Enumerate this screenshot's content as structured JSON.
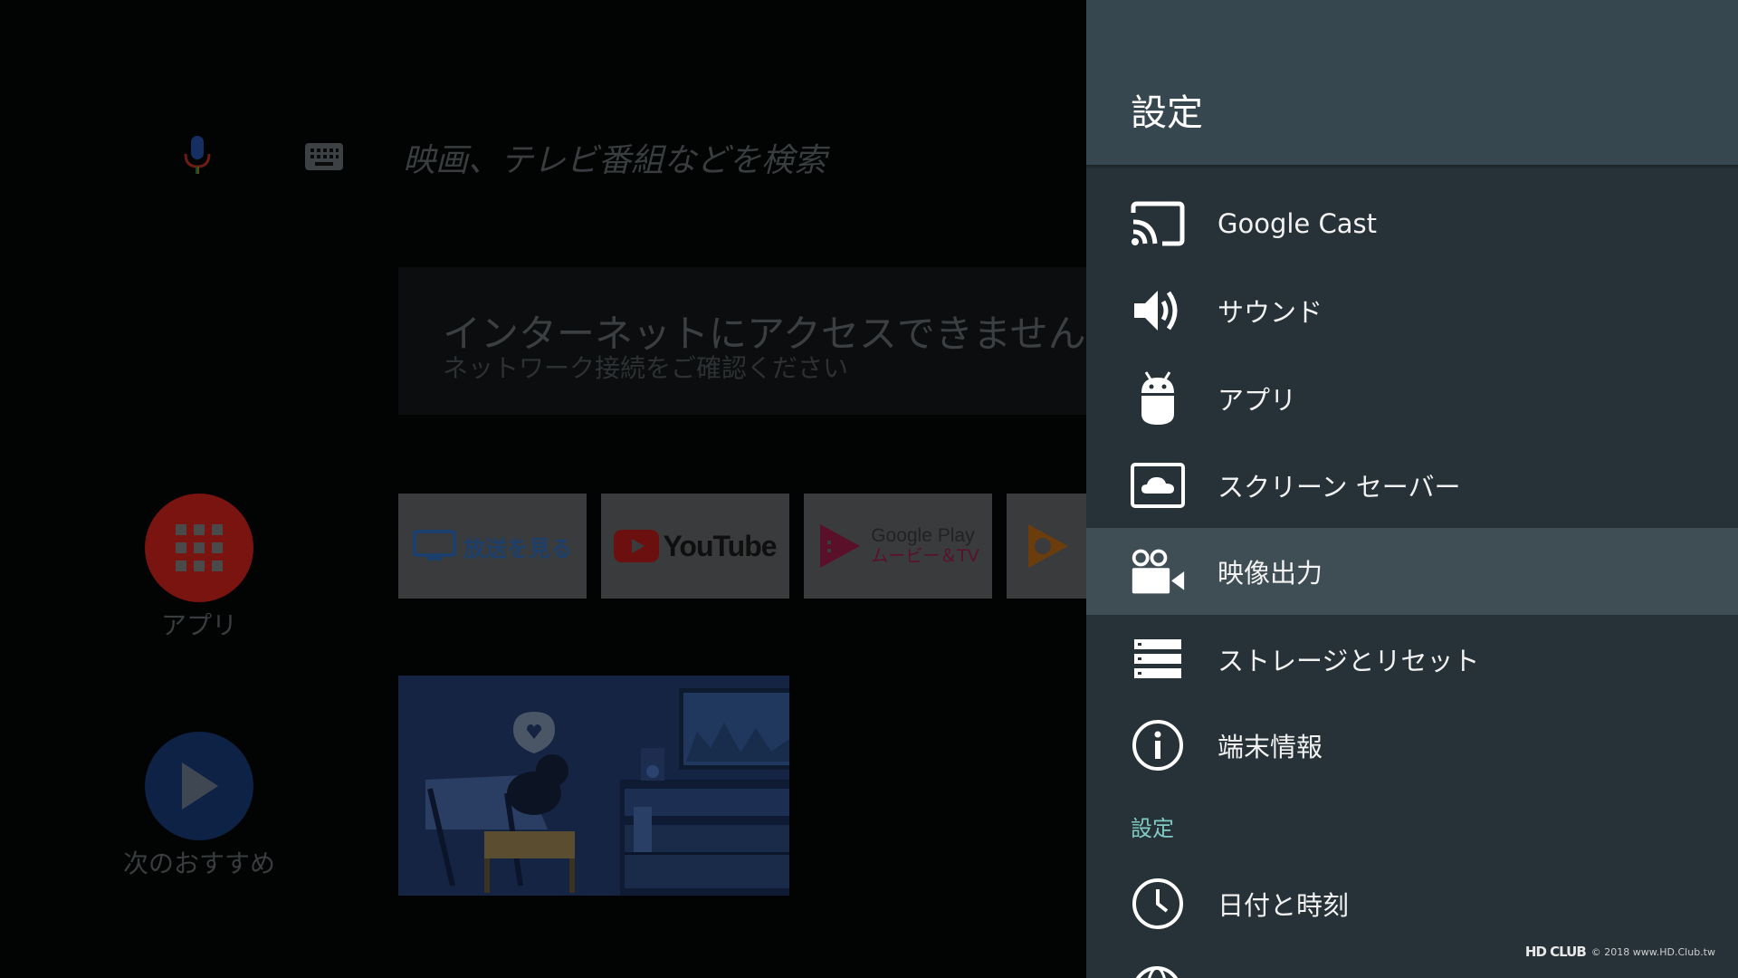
{
  "search": {
    "placeholder": "映画、テレビ番組などを検索"
  },
  "banner": {
    "title": "インターネットにアクセスできません",
    "subtitle": "ネットワーク接続をご確認ください"
  },
  "left_nav": [
    {
      "label": "アプリ",
      "icon": "apps-grid-icon"
    },
    {
      "label": "次のおすすめ",
      "icon": "play-icon"
    }
  ],
  "app_tiles": [
    {
      "label": "放送を見る",
      "icon": "tv-icon"
    },
    {
      "label": "YouTube",
      "icon": "youtube-icon"
    },
    {
      "label": "Google Play",
      "sublabel": "ムービー＆TV",
      "icon": "play-movies-icon"
    },
    {
      "label": "",
      "icon": "play-music-icon"
    }
  ],
  "settings": {
    "title": "設定",
    "items": [
      {
        "label": "Google Cast",
        "icon": "cast-icon"
      },
      {
        "label": "サウンド",
        "icon": "volume-icon"
      },
      {
        "label": "アプリ",
        "icon": "android-icon"
      },
      {
        "label": "スクリーン セーバー",
        "icon": "screensaver-icon"
      },
      {
        "label": "映像出力",
        "icon": "video-camera-icon",
        "selected": true
      },
      {
        "label": "ストレージとリセット",
        "icon": "storage-icon"
      },
      {
        "label": "端末情報",
        "icon": "info-icon"
      }
    ],
    "section_header": "設定",
    "section_items": [
      {
        "label": "日付と時刻",
        "icon": "clock-icon"
      }
    ]
  },
  "watermark": {
    "text": "© 2018 www.HD.Club.tw",
    "logo": "HD CLUB"
  },
  "colors": {
    "panel_bg": "#263238",
    "panel_header_bg": "#37474f",
    "selected_row": "#3f4d55",
    "section_accent": "#80cbc4",
    "apps_circle": "#7a1410",
    "play_circle": "#0d2244"
  }
}
